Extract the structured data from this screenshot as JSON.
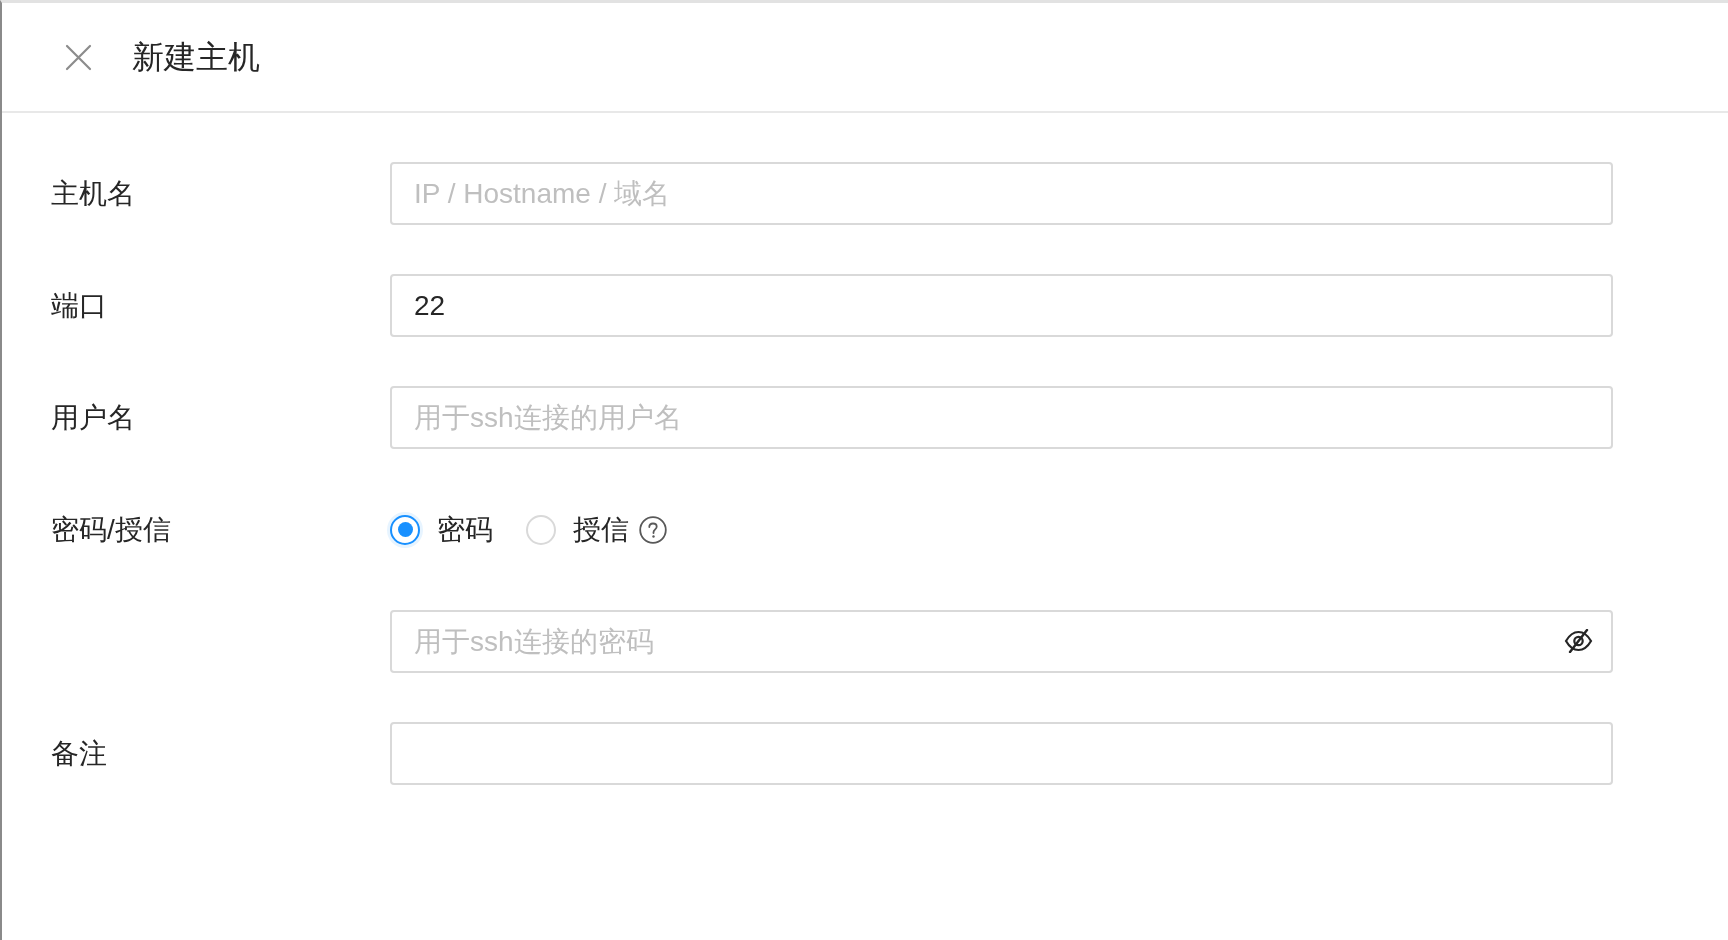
{
  "drawer": {
    "title": "新建主机"
  },
  "form": {
    "fields": [
      {
        "kind": "text",
        "label": "主机名",
        "placeholder": "IP / Hostname / 域名"
      },
      {
        "kind": "text",
        "label": "端口",
        "value": "22"
      },
      {
        "kind": "text",
        "label": "用户名",
        "placeholder": "用于ssh连接的用户名"
      },
      {
        "kind": "radio",
        "label": "密码/授信",
        "options": [
          {
            "label": "密码",
            "selected": true,
            "help": false
          },
          {
            "label": "授信",
            "selected": false,
            "help": true
          }
        ]
      },
      {
        "kind": "password",
        "placeholder": "用于ssh连接的密码",
        "revealed": false
      },
      {
        "kind": "text",
        "label": "备注"
      }
    ]
  }
}
